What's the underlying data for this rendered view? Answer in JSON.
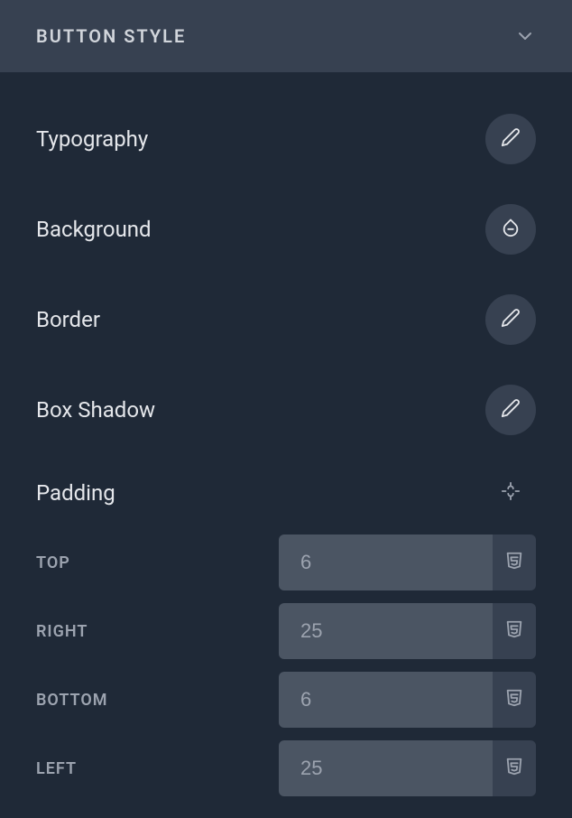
{
  "section": {
    "title": "BUTTON STYLE"
  },
  "styles": {
    "typography": {
      "label": "Typography"
    },
    "background": {
      "label": "Background"
    },
    "border": {
      "label": "Border"
    },
    "boxshadow": {
      "label": "Box Shadow"
    },
    "padding": {
      "label": "Padding"
    }
  },
  "padding": {
    "top": {
      "label": "TOP",
      "placeholder": "6",
      "value": ""
    },
    "right": {
      "label": "RIGHT",
      "placeholder": "25",
      "value": ""
    },
    "bottom": {
      "label": "BOTTOM",
      "placeholder": "6",
      "value": ""
    },
    "left": {
      "label": "LEFT",
      "placeholder": "25",
      "value": ""
    }
  }
}
